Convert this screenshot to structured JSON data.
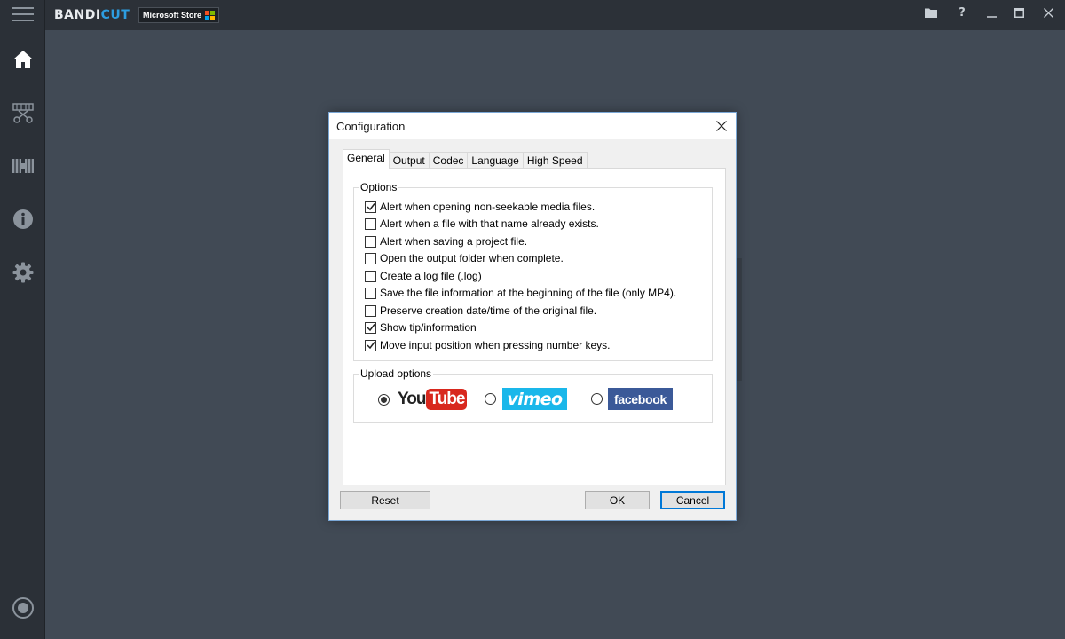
{
  "app": {
    "brand_part1": "BANDI",
    "brand_part2": "CUT",
    "store_badge": "Microsoft Store",
    "colors": {
      "background": "#414a55",
      "sidebar": "#2b3037",
      "accent": "#2d9de0"
    }
  },
  "window_controls": {
    "folder_icon": "folder-icon",
    "help_label": "?",
    "minimize_label": "—",
    "maximize_label": "☐",
    "close_label": "✕"
  },
  "sidebar": {
    "items": [
      {
        "icon": "home-icon",
        "active": true
      },
      {
        "icon": "cut-icon"
      },
      {
        "icon": "join-icon"
      },
      {
        "icon": "info-icon"
      },
      {
        "icon": "settings-icon"
      },
      {
        "icon": "record-icon"
      }
    ]
  },
  "dialog": {
    "title": "Configuration",
    "tabs": [
      {
        "label": "General",
        "active": true
      },
      {
        "label": "Output"
      },
      {
        "label": "Codec"
      },
      {
        "label": "Language"
      },
      {
        "label": "High Speed"
      }
    ],
    "options_group": {
      "label": "Options",
      "items": [
        {
          "label": "Alert when opening non-seekable media files.",
          "checked": true
        },
        {
          "label": "Alert when a file with that name already exists.",
          "checked": false
        },
        {
          "label": "Alert when saving a project file.",
          "checked": false
        },
        {
          "label": "Open the output folder when complete.",
          "checked": false
        },
        {
          "label": "Create a log file (.log)",
          "checked": false
        },
        {
          "label": "Save the file information at the beginning of the file (only MP4).",
          "checked": false
        },
        {
          "label": "Preserve creation date/time of the original file.",
          "checked": false
        },
        {
          "label": "Show tip/information",
          "checked": true
        },
        {
          "label": "Move input position when pressing number keys.",
          "checked": true
        }
      ]
    },
    "upload_group": {
      "label": "Upload options",
      "services": [
        {
          "name": "youtube",
          "logo_text_1": "You",
          "logo_text_2": "Tube",
          "selected": true,
          "color": "#d8281e"
        },
        {
          "name": "vimeo",
          "logo_text": "vimeo",
          "selected": false,
          "color": "#1ab7ea"
        },
        {
          "name": "facebook",
          "logo_text": "facebook",
          "selected": false,
          "color": "#3b5998"
        }
      ]
    },
    "buttons": {
      "reset": "Reset",
      "ok": "OK",
      "cancel": "Cancel"
    }
  }
}
